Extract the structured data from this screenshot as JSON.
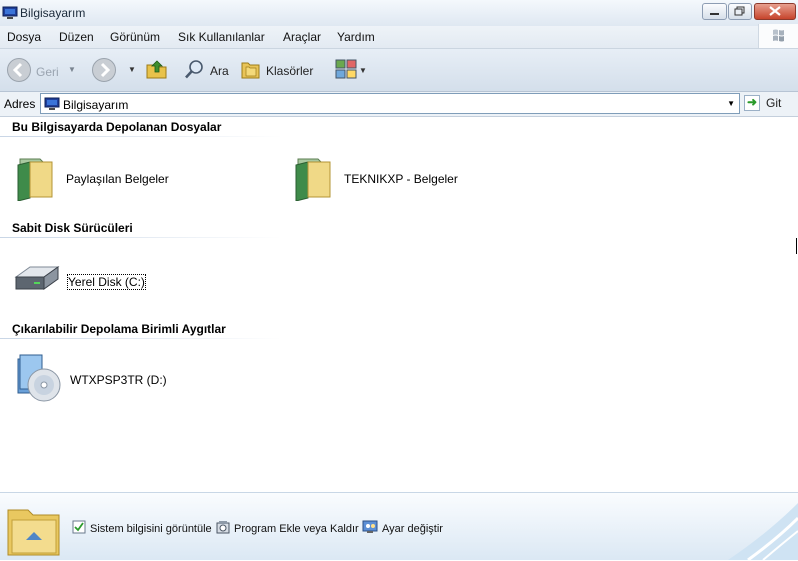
{
  "window": {
    "title": "Bilgisayarım"
  },
  "menu": [
    "Dosya",
    "Düzen",
    "Görünüm",
    "Sık Kullanılanlar",
    "Araçlar",
    "Yardım"
  ],
  "toolbar": {
    "back_label": "Geri",
    "search_label": "Ara",
    "folders_label": "Klasörler"
  },
  "address": {
    "label": "Adres",
    "value": "Bilgisayarım",
    "go_label": "Git"
  },
  "groups": [
    {
      "title": "Bu Bilgisayarda Depolanan Dosyalar",
      "items": [
        {
          "label": "Paylaşılan Belgeler"
        },
        {
          "label": "TEKNIKXP - Belgeler"
        }
      ]
    },
    {
      "title": "Sabit Disk Sürücüleri",
      "items": [
        {
          "label": "Yerel Disk (C:)"
        }
      ]
    },
    {
      "title": "Çıkarılabilir Depolama Birimli Aygıtlar",
      "items": [
        {
          "label": "WTXPSP3TR (D:)"
        }
      ]
    }
  ],
  "tasks": [
    "Sistem bilgisini görüntüle",
    "Program Ekle veya Kaldır",
    "Ayar değiştir"
  ]
}
